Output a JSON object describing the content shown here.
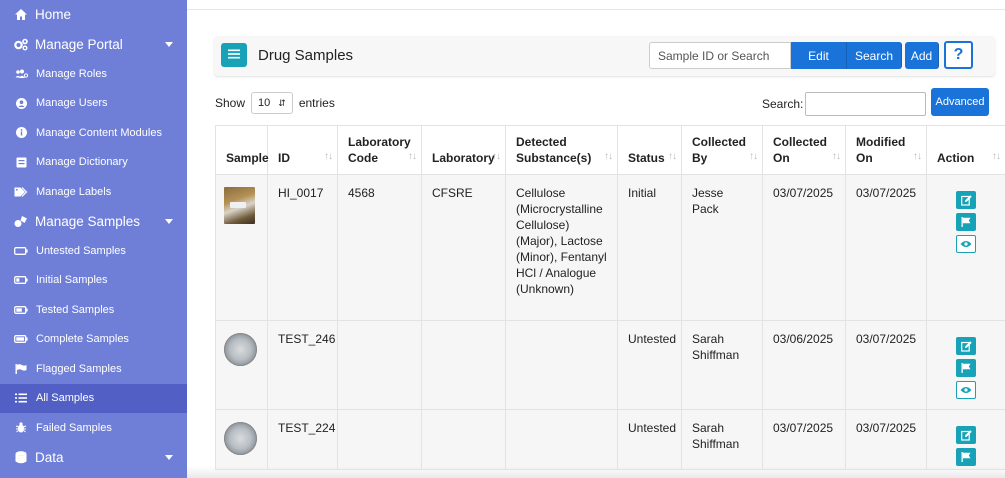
{
  "sidebar": {
    "home": "Home",
    "manage_portal": "Manage Portal",
    "portal_items": [
      "Manage Roles",
      "Manage Users",
      "Manage Content Modules",
      "Manage Dictionary",
      "Manage Labels"
    ],
    "manage_samples": "Manage Samples",
    "sample_items": [
      "Untested Samples",
      "Initial Samples",
      "Tested Samples",
      "Complete Samples",
      "Flagged Samples",
      "All Samples",
      "Failed Samples"
    ],
    "data": "Data"
  },
  "panel": {
    "title": "Drug Samples",
    "search_placeholder": "Sample ID or Search",
    "edit": "Edit",
    "search": "Search",
    "add": "Add",
    "help": "?"
  },
  "controls": {
    "show": "Show",
    "entries_value": "10",
    "entries": "entries",
    "search_label": "Search:",
    "advanced": "Advanced"
  },
  "table": {
    "headers": [
      "Sample",
      "ID",
      "Laboratory Code",
      "Laboratory",
      "Detected Substance(s)",
      "Status",
      "Collected By",
      "Collected On",
      "Modified On",
      "Action"
    ],
    "rows": [
      {
        "id": "HI_0017",
        "lab_code": "4568",
        "lab": "CFSRE",
        "substances": "Cellulose (Microcrystalline Cellulose) (Major), Lactose (Minor), Fentanyl HCl / Analogue (Unknown)",
        "status": "Initial",
        "collected_by": "Jesse Pack",
        "collected_on": "03/07/2025",
        "modified_on": "03/07/2025"
      },
      {
        "id": "TEST_246",
        "lab_code": "",
        "lab": "",
        "substances": "",
        "status": "Untested",
        "collected_by": "Sarah Shiffman",
        "collected_on": "03/06/2025",
        "modified_on": "03/07/2025"
      },
      {
        "id": "TEST_224",
        "lab_code": "",
        "lab": "",
        "substances": "",
        "status": "Untested",
        "collected_by": "Sarah Shiffman",
        "collected_on": "03/07/2025",
        "modified_on": "03/07/2025"
      }
    ]
  },
  "icons": {
    "menu": "hamburger-icon",
    "row_edit": "edit-icon",
    "row_flag": "flag-icon",
    "row_view": "eye-icon"
  },
  "colors": {
    "sidebar": "#6f7fd8",
    "sidebar_active": "#5260c6",
    "primary": "#1a73d9",
    "info": "#17a2b8"
  }
}
